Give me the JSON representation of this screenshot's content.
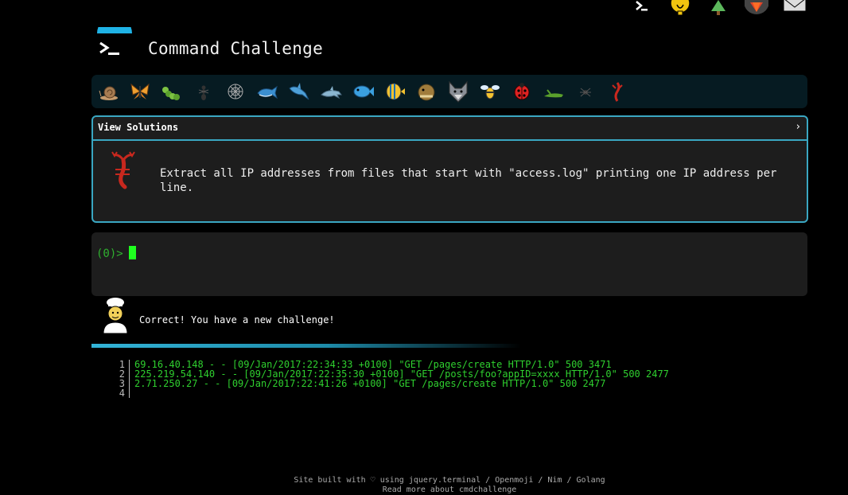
{
  "header": {
    "title": "Command Challenge"
  },
  "top_icons": [
    "terminal-icon",
    "lightbulb-icon",
    "tree-icon",
    "gitlab-icon",
    "mail-icon"
  ],
  "critters": [
    "snail-icon",
    "butterfly-icon",
    "caterpillar-icon",
    "ant-icon",
    "spider-web-icon",
    "whale-icon",
    "shark-icon",
    "dolphin-icon",
    "fish-icon",
    "tropical-fish-icon",
    "blowfish-icon",
    "wolf-icon",
    "bee-icon",
    "ladybug-icon",
    "cricket-icon",
    "spider-icon",
    "scorpion-icon"
  ],
  "challenge": {
    "view_solutions": "View Solutions",
    "chevron": "›",
    "description": "Extract all IP addresses from files that start with \"access.log\" printing one IP address per line."
  },
  "terminal": {
    "prompt": "(0)>"
  },
  "response": {
    "message": "Correct! You have a new challenge!"
  },
  "output": {
    "lines": [
      {
        "num": "1",
        "text": "69.16.40.148 - - [09/Jan/2017:22:34:33 +0100] \"GET /pages/create HTTP/1.0\" 500 3471"
      },
      {
        "num": "2",
        "text": "225.219.54.140 - - [09/Jan/2017:22:35:30 +0100] \"GET /posts/foo?appID=xxxx HTTP/1.0\" 500 2477"
      },
      {
        "num": "3",
        "text": "2.71.250.27 - - [09/Jan/2017:22:41:26 +0100] \"GET /pages/create HTTP/1.0\" 500 2477"
      },
      {
        "num": "4",
        "text": ""
      }
    ]
  },
  "footer": {
    "line1": "Site built with ♡ using jquery.terminal / Openmoji / Nim / Golang",
    "line2": "Read more about cmdchallenge"
  },
  "colors": {
    "accent": "#3aa7c2",
    "terminal_green": "#2fd02f",
    "cursor": "#1fff1f",
    "panel_bg": "#1d1d1d",
    "critter_bar_bg": "#061b22"
  }
}
